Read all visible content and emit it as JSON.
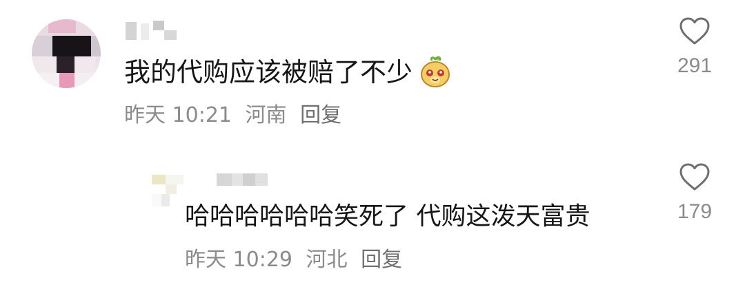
{
  "comments": [
    {
      "text": "我的代购应该被赔了不少",
      "sticker": "smiling-face-sticker-icon",
      "time": "昨天 10:21",
      "location": "河南",
      "reply_label": "回复",
      "likes": "291"
    },
    {
      "text": "哈哈哈哈哈哈笑死了 代购这泼天富贵",
      "time": "昨天 10:29",
      "location": "河北",
      "reply_label": "回复",
      "likes": "179"
    }
  ],
  "colors": {
    "text": "#161616",
    "meta": "#8b8b8b",
    "icon": "#6e6e6e"
  }
}
